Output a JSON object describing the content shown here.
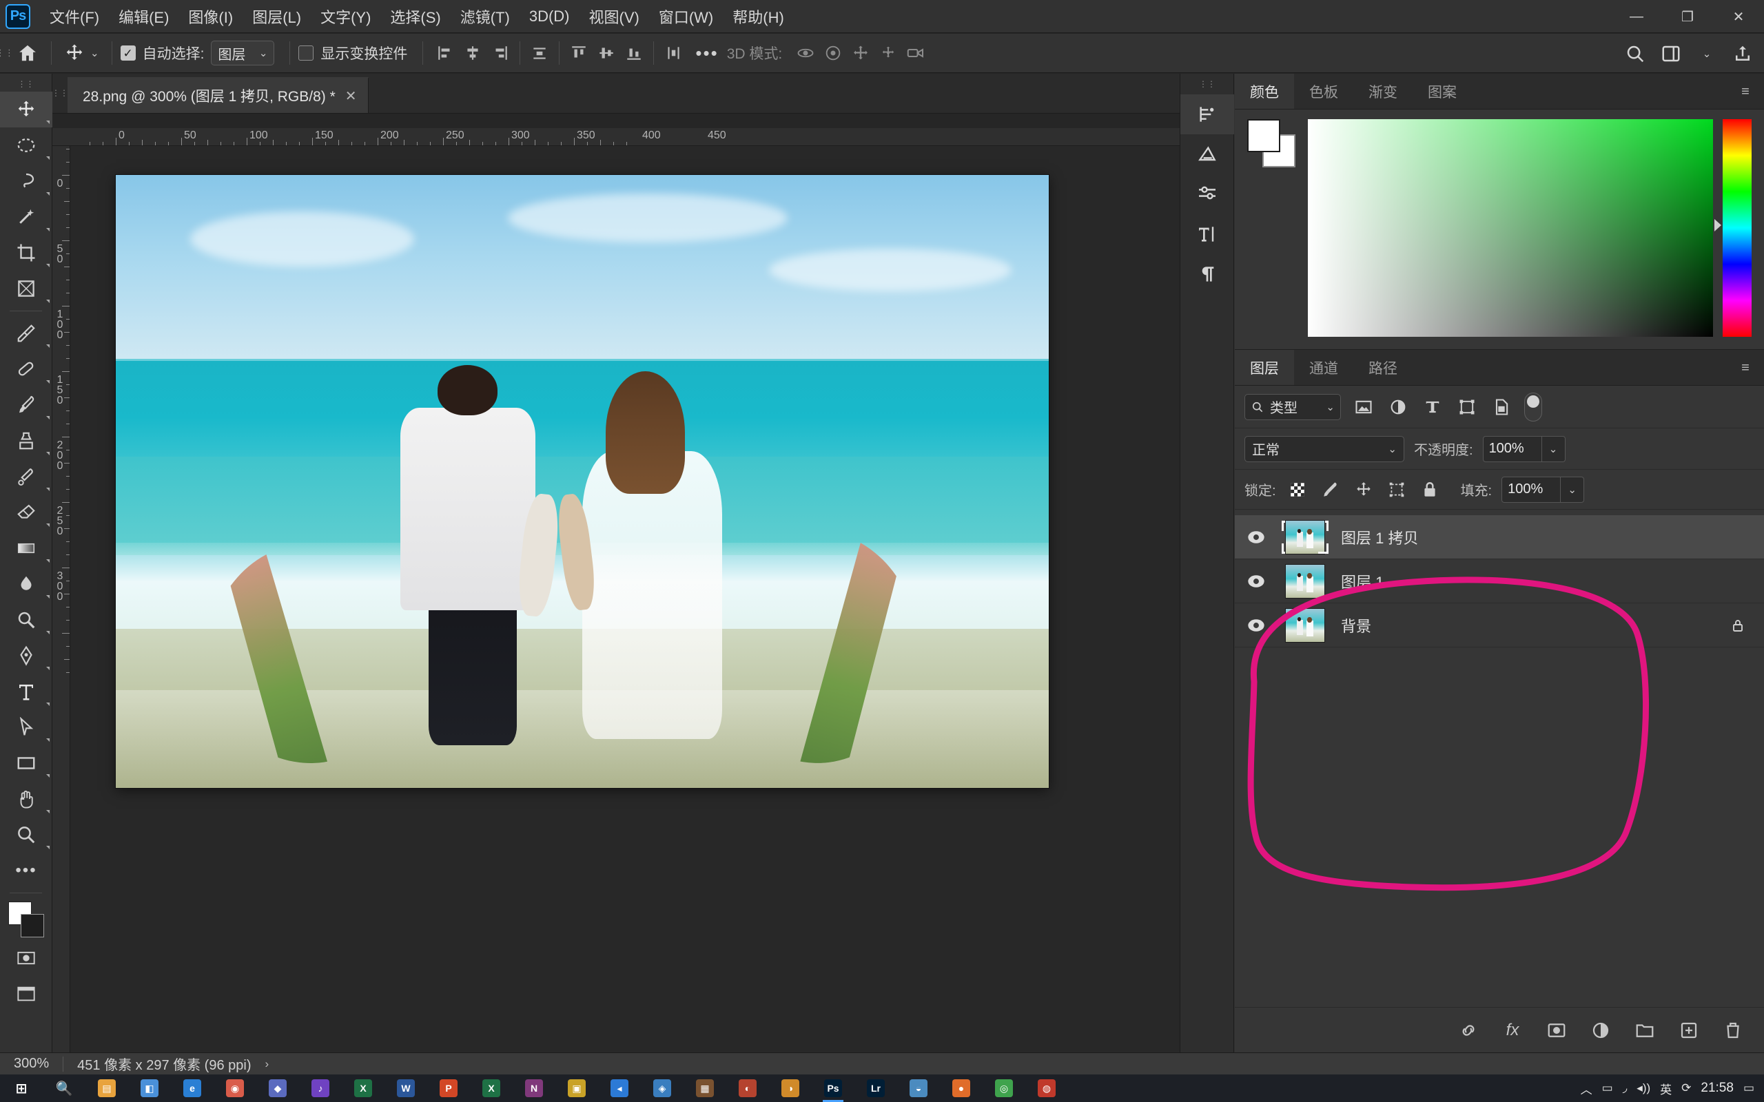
{
  "app": {
    "logo": "Ps",
    "name": "Adobe Photoshop"
  },
  "menubar": {
    "items": [
      {
        "label": "文件(F)",
        "name": "menu-file"
      },
      {
        "label": "编辑(E)",
        "name": "menu-edit"
      },
      {
        "label": "图像(I)",
        "name": "menu-image"
      },
      {
        "label": "图层(L)",
        "name": "menu-layer"
      },
      {
        "label": "文字(Y)",
        "name": "menu-type"
      },
      {
        "label": "选择(S)",
        "name": "menu-select"
      },
      {
        "label": "滤镜(T)",
        "name": "menu-filter"
      },
      {
        "label": "3D(D)",
        "name": "menu-3d"
      },
      {
        "label": "视图(V)",
        "name": "menu-view"
      },
      {
        "label": "窗口(W)",
        "name": "menu-window"
      },
      {
        "label": "帮助(H)",
        "name": "menu-help"
      }
    ],
    "window_controls": {
      "minimize": "—",
      "restore": "❐",
      "close": "✕"
    }
  },
  "options_bar": {
    "home_icon": "home-icon",
    "tool_icon": "move-tool-icon",
    "tool_caret": "⌄",
    "auto_select_label": "自动选择:",
    "auto_select_checked": true,
    "auto_select_value": "图层",
    "auto_select_caret": "⌄",
    "show_transform_label": "显示变换控件",
    "show_transform_checked": false,
    "more_options": "•••",
    "mode_3d_label": "3D 模式:",
    "align_icons": [
      "align-left-icon",
      "align-center-h-icon",
      "align-right-icon",
      "distribute-h-icon",
      "align-top-icon",
      "align-middle-v-icon",
      "align-bottom-icon",
      "distribute-v-icon"
    ],
    "mode_3d_icons": [
      "orbit-3d-icon",
      "roll-3d-icon",
      "pan-3d-icon",
      "slide-3d-icon",
      "camera-3d-icon"
    ],
    "right_icons": [
      "search-icon",
      "workspace-icon",
      "chevron-down-icon",
      "share-icon"
    ]
  },
  "document_tab": {
    "title": "28.png @ 300% (图层 1 拷贝, RGB/8) *",
    "close": "✕"
  },
  "rulers": {
    "horizontal_labels": [
      "0",
      "50",
      "100",
      "150",
      "200",
      "250",
      "300",
      "350",
      "400",
      "450"
    ],
    "vertical_labels": [
      "50",
      "0",
      "50",
      "100",
      "150",
      "200",
      "250",
      "300"
    ]
  },
  "toolbar": {
    "tools": [
      {
        "name": "move-tool",
        "icon": "move-icon",
        "selected": true
      },
      {
        "name": "marquee-tool",
        "icon": "marquee-ellipse-icon",
        "selected": false
      },
      {
        "name": "lasso-tool",
        "icon": "lasso-icon",
        "selected": false
      },
      {
        "name": "quick-select-tool",
        "icon": "magic-wand-icon",
        "selected": false
      },
      {
        "name": "crop-tool",
        "icon": "crop-icon",
        "selected": false
      },
      {
        "name": "frame-tool",
        "icon": "frame-icon",
        "selected": false
      },
      {
        "name": "eyedropper-tool",
        "icon": "eyedropper-icon",
        "selected": false
      },
      {
        "name": "spot-healing-tool",
        "icon": "healing-brush-icon",
        "selected": false
      },
      {
        "name": "brush-tool",
        "icon": "brush-icon",
        "selected": false
      },
      {
        "name": "clone-stamp-tool",
        "icon": "clone-stamp-icon",
        "selected": false
      },
      {
        "name": "history-brush-tool",
        "icon": "history-brush-icon",
        "selected": false
      },
      {
        "name": "eraser-tool",
        "icon": "eraser-icon",
        "selected": false
      },
      {
        "name": "gradient-tool",
        "icon": "gradient-icon",
        "selected": false
      },
      {
        "name": "blur-tool",
        "icon": "blur-drop-icon",
        "selected": false
      },
      {
        "name": "dodge-tool",
        "icon": "dodge-icon",
        "selected": false
      },
      {
        "name": "pen-tool",
        "icon": "pen-icon",
        "selected": false
      },
      {
        "name": "type-tool",
        "icon": "type-T-icon",
        "selected": false
      },
      {
        "name": "path-select-tool",
        "icon": "path-arrow-icon",
        "selected": false
      },
      {
        "name": "rectangle-tool",
        "icon": "rectangle-icon",
        "selected": false
      },
      {
        "name": "hand-tool",
        "icon": "hand-icon",
        "selected": false
      },
      {
        "name": "zoom-tool",
        "icon": "zoom-magnifier-icon",
        "selected": false
      },
      {
        "name": "more-tools",
        "icon": "ellipsis-icon",
        "selected": false
      }
    ],
    "foreground_color": "#ffffff",
    "background_color": "#ffffff",
    "quickmask_icon": "quick-mask-icon",
    "screenmode_icon": "screen-mode-icon"
  },
  "icon_dock": {
    "icons": [
      {
        "name": "history-panel-icon",
        "active": true
      },
      {
        "name": "adjustments-panel-icon",
        "active": false
      },
      {
        "name": "properties-panel-icon",
        "active": false
      },
      {
        "name": "character-panel-icon",
        "active": false
      },
      {
        "name": "paragraph-panel-icon",
        "active": false
      }
    ]
  },
  "color_panel": {
    "tabs": [
      {
        "label": "颜色",
        "active": true
      },
      {
        "label": "色板",
        "active": false
      },
      {
        "label": "渐变",
        "active": false
      },
      {
        "label": "图案",
        "active": false
      }
    ],
    "menu_icon": "panel-menu-icon",
    "foreground_hex": "#ffffff",
    "background_hex": "#ffffff",
    "picker_base_hex": "#00d91e"
  },
  "layers_panel": {
    "tabs": [
      {
        "label": "图层",
        "active": true
      },
      {
        "label": "通道",
        "active": false
      },
      {
        "label": "路径",
        "active": false
      }
    ],
    "menu_icon": "panel-menu-icon",
    "filter": {
      "search_icon": "search-icon",
      "type_label": "类型",
      "caret": "⌄",
      "icons": [
        "filter-image-icon",
        "filter-adjustment-icon",
        "filter-text-icon",
        "filter-shape-icon",
        "filter-smartobject-icon"
      ],
      "toggle": "filter-enable-toggle"
    },
    "blend_mode": "正常",
    "blend_caret": "⌄",
    "opacity_label": "不透明度:",
    "opacity_value": "100%",
    "lock_label": "锁定:",
    "lock_icons": [
      "lock-transparency-icon",
      "lock-image-icon",
      "lock-position-icon",
      "lock-artboard-icon",
      "lock-all-icon"
    ],
    "fill_label": "填充:",
    "fill_value": "100%",
    "layers": [
      {
        "name": "图层 1 拷贝",
        "visible": true,
        "selected": true,
        "locked": false,
        "eye": "eye-icon"
      },
      {
        "name": "图层 1",
        "visible": true,
        "selected": false,
        "locked": false,
        "eye": "eye-icon"
      },
      {
        "name": "背景",
        "visible": true,
        "selected": false,
        "locked": true,
        "eye": "eye-icon"
      }
    ],
    "footer_icons": [
      "link-layers-icon",
      "layer-style-fx-icon",
      "add-mask-icon",
      "adjustment-layer-icon",
      "new-group-icon",
      "new-layer-icon",
      "delete-layer-icon"
    ],
    "fx_label": "fx"
  },
  "annotation": {
    "shape": "hand-drawn-circle",
    "color": "#e0157f"
  },
  "status_bar": {
    "zoom": "300%",
    "dimensions": "451 像素 x 297 像素 (96 ppi)",
    "arrow": "›"
  },
  "taskbar": {
    "items": [
      {
        "name": "start-button",
        "glyph": "⊞",
        "color": "#1d2026"
      },
      {
        "name": "search-taskbar",
        "glyph": "🔍",
        "color": "#1d2026"
      },
      {
        "name": "folder-icon",
        "glyph": "▤",
        "color": "#e8a33d"
      },
      {
        "name": "app-icon-1",
        "glyph": "◧",
        "color": "#4a90d9"
      },
      {
        "name": "edge-icon",
        "glyph": "e",
        "color": "#2a7fd4"
      },
      {
        "name": "chrome-icon",
        "glyph": "◉",
        "color": "#d95c4a"
      },
      {
        "name": "app-icon-2",
        "glyph": "◆",
        "color": "#5b6bbf"
      },
      {
        "name": "app-icon-3",
        "glyph": "♪",
        "color": "#6f42c1"
      },
      {
        "name": "excel-icon",
        "glyph": "X",
        "color": "#1e7145"
      },
      {
        "name": "word-icon",
        "glyph": "W",
        "color": "#2b579a"
      },
      {
        "name": "ppt-icon",
        "glyph": "P",
        "color": "#d24726"
      },
      {
        "name": "excel-icon-2",
        "glyph": "X",
        "color": "#1e7145"
      },
      {
        "name": "onenote-icon",
        "glyph": "N",
        "color": "#80397b"
      },
      {
        "name": "app-icon-4",
        "glyph": "▣",
        "color": "#c9a227"
      },
      {
        "name": "vscode-icon",
        "glyph": "◂",
        "color": "#2c7ad6"
      },
      {
        "name": "app-icon-5",
        "glyph": "◈",
        "color": "#3a7ebf"
      },
      {
        "name": "app-icon-6",
        "glyph": "▦",
        "color": "#7a5230"
      },
      {
        "name": "app-icon-7",
        "glyph": "◐",
        "color": "#b5432f"
      },
      {
        "name": "app-icon-8",
        "glyph": "◑",
        "color": "#d08a2a"
      },
      {
        "name": "photoshop-taskbar-icon",
        "glyph": "Ps",
        "color": "#001e36",
        "active": true
      },
      {
        "name": "lightroom-icon",
        "glyph": "Lr",
        "color": "#001e36"
      },
      {
        "name": "app-icon-9",
        "glyph": "◒",
        "color": "#4b8bbf"
      },
      {
        "name": "app-icon-10",
        "glyph": "●",
        "color": "#e06c2a"
      },
      {
        "name": "app-icon-11",
        "glyph": "◎",
        "color": "#3fa34d"
      },
      {
        "name": "app-icon-12",
        "glyph": "◍",
        "color": "#c0392b"
      }
    ],
    "tray": {
      "chevron": "︿",
      "icons": [
        "battery-icon",
        "wifi-icon",
        "volume-icon"
      ],
      "ime": "英",
      "extra_icon": "sync-icon",
      "clock": "21:58",
      "notification": "▭"
    }
  }
}
